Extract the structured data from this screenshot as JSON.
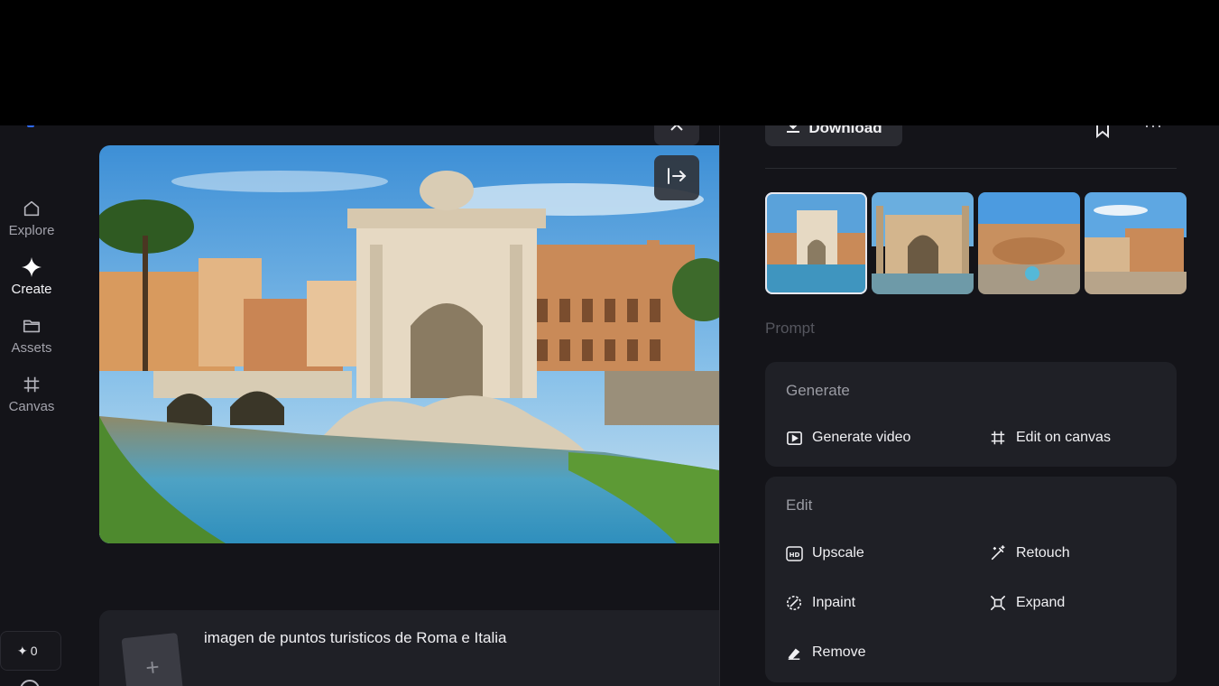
{
  "sidebar": {
    "items": [
      {
        "label": "Explore",
        "icon": "home-icon"
      },
      {
        "label": "Create",
        "icon": "diamond-icon"
      },
      {
        "label": "Assets",
        "icon": "folder-icon"
      },
      {
        "label": "Canvas",
        "icon": "grid-icon"
      }
    ],
    "credits": "0"
  },
  "main": {
    "prompt_text": "imagen de puntos turisticos de Roma e Italia"
  },
  "panel": {
    "download_label": "Download",
    "prompt_label": "Prompt",
    "generate": {
      "title": "Generate",
      "actions": [
        "Generate video",
        "Edit on canvas"
      ]
    },
    "edit": {
      "title": "Edit",
      "actions": [
        "Upscale",
        "Retouch",
        "Inpaint",
        "Expand",
        "Remove"
      ]
    }
  },
  "colors": {
    "background": "#141419",
    "card": "#1f2026",
    "accent": "#2f6bff"
  }
}
